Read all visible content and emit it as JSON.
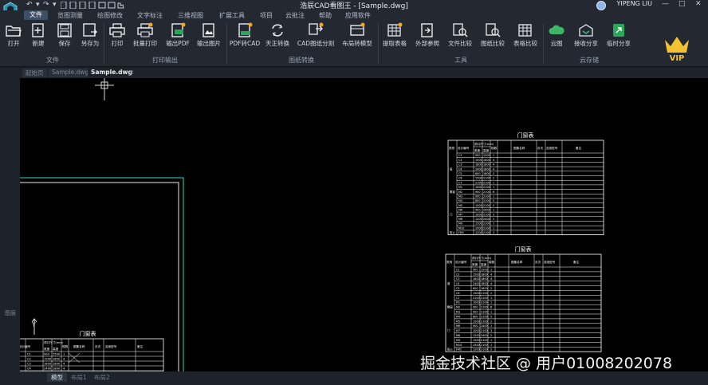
{
  "app": {
    "title": "浩辰CAD看图王 - [Sample.dwg]",
    "user": "YIPENG LIU",
    "window_controls": [
      "—",
      "□",
      "✕"
    ]
  },
  "menu": {
    "tabs": [
      "文件",
      "览图测量",
      "绘图修改",
      "文字标注",
      "三维视图",
      "扩展工具",
      "项目",
      "云批注",
      "帮助",
      "应用软件"
    ]
  },
  "ribbon": {
    "buttons": [
      "打开",
      "新建",
      "保存",
      "另存为",
      "打印",
      "批量打印",
      "输出PDF",
      "输出图片",
      "PDF转CAD",
      "天正转换",
      "CAD图纸分割",
      "布局转模型",
      "提取表格",
      "外部参照",
      "文件比较",
      "图纸比较",
      "表格比较",
      "云图",
      "接收分享",
      "临时分享"
    ],
    "groups": [
      "文件",
      "打印输出",
      "图纸转换",
      "工具",
      "云存储"
    ],
    "vip": "VIP"
  },
  "doc_tabs": {
    "items": [
      "起始页",
      "Sample.dwg",
      "Sample.dwg"
    ],
    "close": "×"
  },
  "side": {
    "label": "图层"
  },
  "layout_tabs": [
    "模型",
    "布局1",
    "布局2"
  ],
  "drawing": {
    "table_title": "门窗表",
    "headers": [
      "类别",
      "设计编号",
      "洞口尺寸(mm)",
      "宽度",
      "高度",
      "樘数",
      "图集名称",
      "页次",
      "选用型号",
      "备注"
    ],
    "codes": [
      "C1",
      "C2",
      "C3",
      "C4",
      "C5",
      "C6",
      "C7",
      "M1",
      "M2",
      "M3",
      "M4",
      "M5",
      "M6",
      "M7",
      "M8",
      "M9",
      "M10",
      "FM1"
    ],
    "row_labels": [
      "窗",
      "飘窗",
      "门",
      "防火"
    ],
    "widths": [
      "900",
      "1500",
      "1800",
      "2400",
      "600",
      "1500",
      "2100",
      "1000",
      "900",
      "900",
      "800",
      "1500",
      "900",
      "1000",
      "1200",
      "1500",
      "1500",
      "1200"
    ],
    "heights": [
      "1500",
      "1800",
      "1800",
      "1800",
      "1800",
      "2100",
      "2100",
      "2100",
      "2100",
      "2100",
      "2100",
      "2100",
      "2400",
      "2100",
      "2400",
      "2100",
      "2100",
      "2100"
    ],
    "counts": [
      "1",
      "4",
      "4",
      "4",
      "2",
      "2",
      "1",
      "1",
      "8",
      "1",
      "5",
      "2",
      "1",
      "3",
      "2",
      "1",
      "1",
      "2"
    ]
  },
  "watermark": "掘金技术社区 @ 用户01008202078"
}
